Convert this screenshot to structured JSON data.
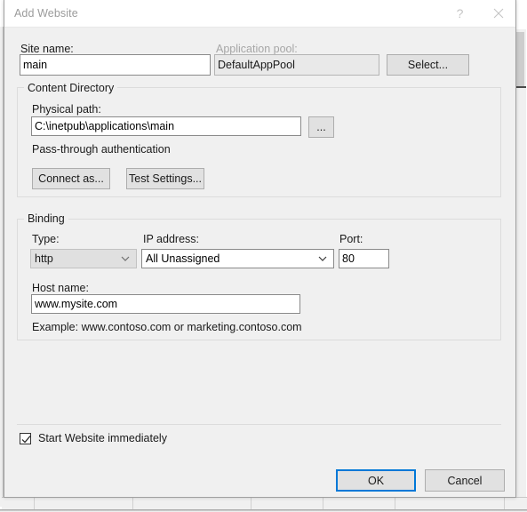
{
  "window": {
    "title": "Add Website",
    "help_icon": "question-mark-icon",
    "close_icon": "close-icon"
  },
  "site_name": {
    "label": "Site name:",
    "value": "main"
  },
  "application_pool": {
    "label": "Application pool:",
    "value": "DefaultAppPool",
    "select_button": "Select...",
    "disabled": true
  },
  "content_directory": {
    "group_title": "Content Directory",
    "physical_path": {
      "label": "Physical path:",
      "value": "C:\\inetpub\\applications\\main",
      "browse_button": "..."
    },
    "pass_through_label": "Pass-through authentication",
    "connect_as_button": "Connect as...",
    "test_settings_button": "Test Settings..."
  },
  "binding": {
    "group_title": "Binding",
    "type": {
      "label": "Type:",
      "value": "http",
      "disabled": true
    },
    "ip_address": {
      "label": "IP address:",
      "value": "All Unassigned"
    },
    "port": {
      "label": "Port:",
      "value": "80"
    },
    "host_name": {
      "label": "Host name:",
      "value": "www.mysite.com"
    },
    "example_text": "Example: www.contoso.com or marketing.contoso.com"
  },
  "footer": {
    "start_website_label": "Start Website immediately",
    "start_website_checked": true,
    "ok_button": "OK",
    "cancel_button": "Cancel"
  },
  "colors": {
    "dialog_bg": "#f0f0f0",
    "titlebar_bg": "#ffffff",
    "accent_focus": "#0078d7",
    "disabled_text": "#a6a6a6",
    "field_border": "#8a8a8a"
  }
}
